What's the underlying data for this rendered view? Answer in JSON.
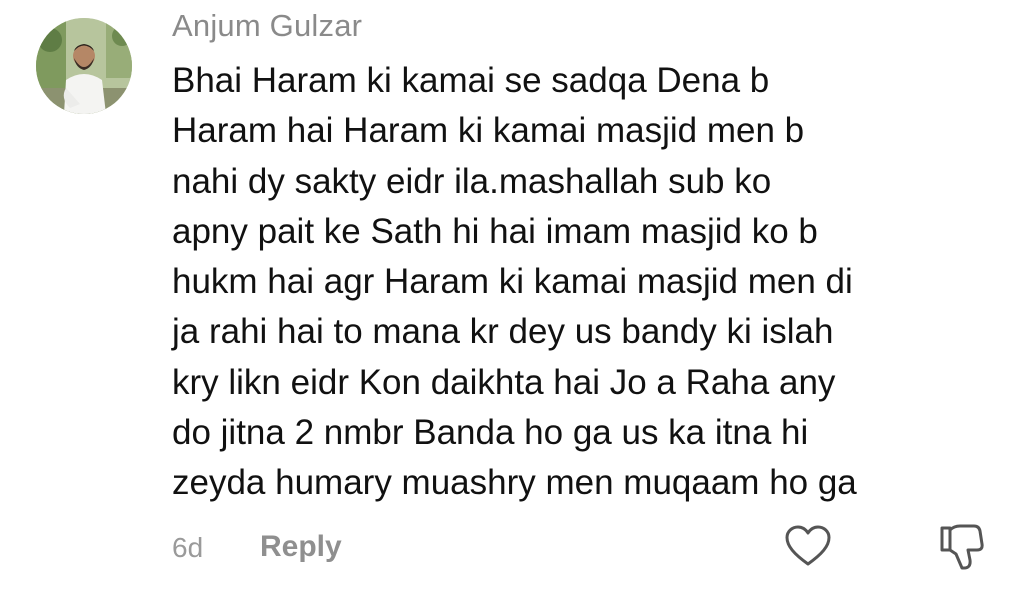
{
  "comment": {
    "username": "Anjum Gulzar",
    "avatar_icon": "user-avatar-photo",
    "lines": [
      "Bhai Haram ki kamai se sadqa Dena b",
      "Haram hai Haram ki kamai masjid men b",
      "nahi dy sakty eidr ila.mashallah sub ko",
      "apny pait ke Sath hi hai imam masjid ko b",
      "hukm hai agr Haram ki kamai masjid men di",
      "ja rahi hai to mana kr dey us bandy ki islah",
      "kry likn eidr Kon daikhta hai Jo a Raha any",
      "do jitna 2 nmbr Banda ho ga us ka itna hi",
      "zeyda humary muashry men muqaam ho ga"
    ],
    "timestamp": "6d",
    "reply_label": "Reply",
    "like_icon": "heart-icon",
    "dislike_icon": "thumbs-down-icon"
  },
  "colors": {
    "username": "#8a8a8a",
    "body_text": "#111111",
    "meta_text": "#9a9a9a",
    "icon_stroke": "#555555"
  }
}
